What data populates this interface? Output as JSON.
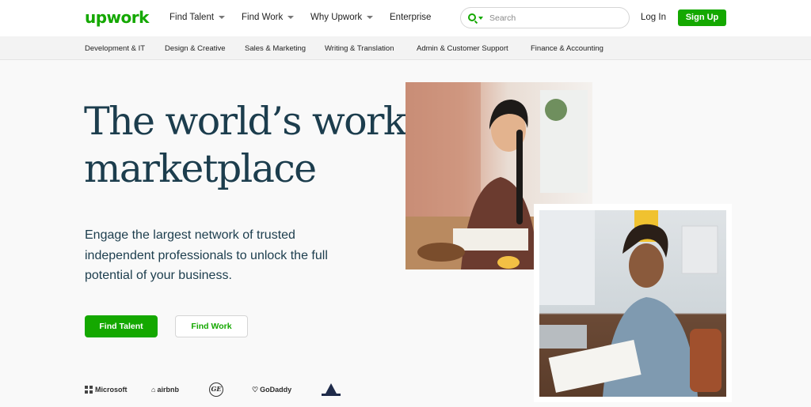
{
  "header": {
    "logo": "upwork",
    "nav": [
      "Find Talent",
      "Find Work",
      "Why Upwork",
      "Enterprise"
    ],
    "search_placeholder": "Search",
    "login": "Log In",
    "signup": "Sign Up"
  },
  "categories": [
    "Development & IT",
    "Design & Creative",
    "Sales & Marketing",
    "Writing & Translation",
    "Admin & Customer Support",
    "Finance & Accounting"
  ],
  "hero": {
    "headline_line1": "The world’s work",
    "headline_line2": "marketplace",
    "subtitle": "Engage the largest network of trusted independent professionals to unlock the full potential of your business.",
    "primary_button": "Find Talent",
    "secondary_button": "Find Work"
  },
  "logos": [
    "Microsoft",
    "airbnb",
    "GE",
    "GoDaddy",
    "bissell"
  ],
  "colors": {
    "brand_green": "#14a800",
    "headline": "#1c3d4d"
  }
}
